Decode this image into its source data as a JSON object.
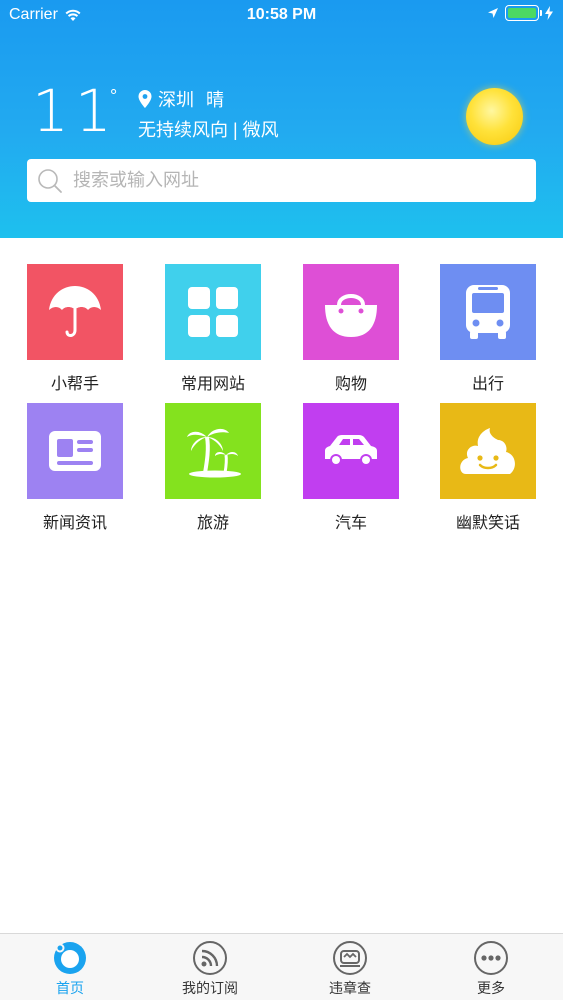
{
  "status_bar": {
    "carrier": "Carrier",
    "time": "10:58 PM",
    "battery_level": 1.0
  },
  "weather": {
    "temperature": "11",
    "degree_symbol": "°",
    "city": "深圳",
    "condition": "晴",
    "wind": "无持续风向 | 微风",
    "icon": "sun-icon"
  },
  "search": {
    "placeholder": "搜索或输入网址",
    "value": ""
  },
  "apps": [
    {
      "label": "小帮手",
      "icon": "umbrella-icon",
      "color": "#f25464"
    },
    {
      "label": "常用网站",
      "icon": "grid-icon",
      "color": "#40d0ec"
    },
    {
      "label": "购物",
      "icon": "shopping-bag-icon",
      "color": "#de4fd6"
    },
    {
      "label": "出行",
      "icon": "bus-icon",
      "color": "#6e8ef2"
    },
    {
      "label": "新闻资讯",
      "icon": "news-icon",
      "color": "#9d82f2"
    },
    {
      "label": "旅游",
      "icon": "palm-tree-icon",
      "color": "#84e21e"
    },
    {
      "label": "汽车",
      "icon": "car-icon",
      "color": "#c13ef0"
    },
    {
      "label": "幽默笑话",
      "icon": "smiley-blob-icon",
      "color": "#e8b916"
    }
  ],
  "tabbar": {
    "active_color": "#1aa3ef",
    "tabs": [
      {
        "label": "首页",
        "icon": "home-icon",
        "active": true
      },
      {
        "label": "我的订阅",
        "icon": "rss-icon",
        "active": false
      },
      {
        "label": "违章查",
        "icon": "traffic-icon",
        "active": false
      },
      {
        "label": "更多",
        "icon": "more-icon",
        "active": false
      }
    ]
  }
}
